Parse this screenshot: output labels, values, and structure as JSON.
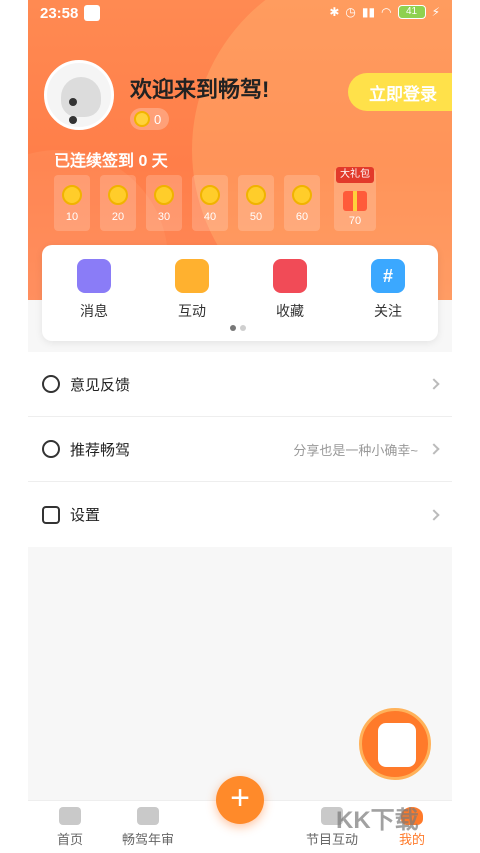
{
  "status_bar": {
    "time": "23:58",
    "battery": "41"
  },
  "header": {
    "welcome": "欢迎来到畅驾!",
    "coins": "0",
    "login_button": "立即登录",
    "checkin_title": "已连续签到 0 天"
  },
  "checkin": {
    "days": [
      "10",
      "20",
      "30",
      "40",
      "50",
      "60"
    ],
    "gift": {
      "tag": "大礼包",
      "value": "70"
    }
  },
  "quick_actions": [
    {
      "label": "消息",
      "icon": "bell-icon"
    },
    {
      "label": "互动",
      "icon": "chat-icon"
    },
    {
      "label": "收藏",
      "icon": "heart-icon"
    },
    {
      "label": "关注",
      "icon": "hash-icon",
      "glyph": "#"
    }
  ],
  "menu": [
    {
      "label": "意见反馈",
      "icon": "feedback-icon",
      "subtitle": ""
    },
    {
      "label": "推荐畅驾",
      "icon": "share-icon",
      "subtitle": "分享也是一种小确幸~"
    },
    {
      "label": "设置",
      "icon": "settings-icon",
      "subtitle": ""
    }
  ],
  "tabbar": {
    "tabs": [
      {
        "label": "首页",
        "icon": "home-icon"
      },
      {
        "label": "畅驾年审",
        "icon": "car-icon"
      },
      {
        "label": "节目互动",
        "icon": "radio-icon"
      },
      {
        "label": "我的",
        "icon": "profile-icon"
      }
    ],
    "add": "+"
  },
  "watermark": "KK下载",
  "colors": {
    "header_gradient": "#ff8a52",
    "accent": "#ff7a2a",
    "login_button": "#ffe14a"
  }
}
